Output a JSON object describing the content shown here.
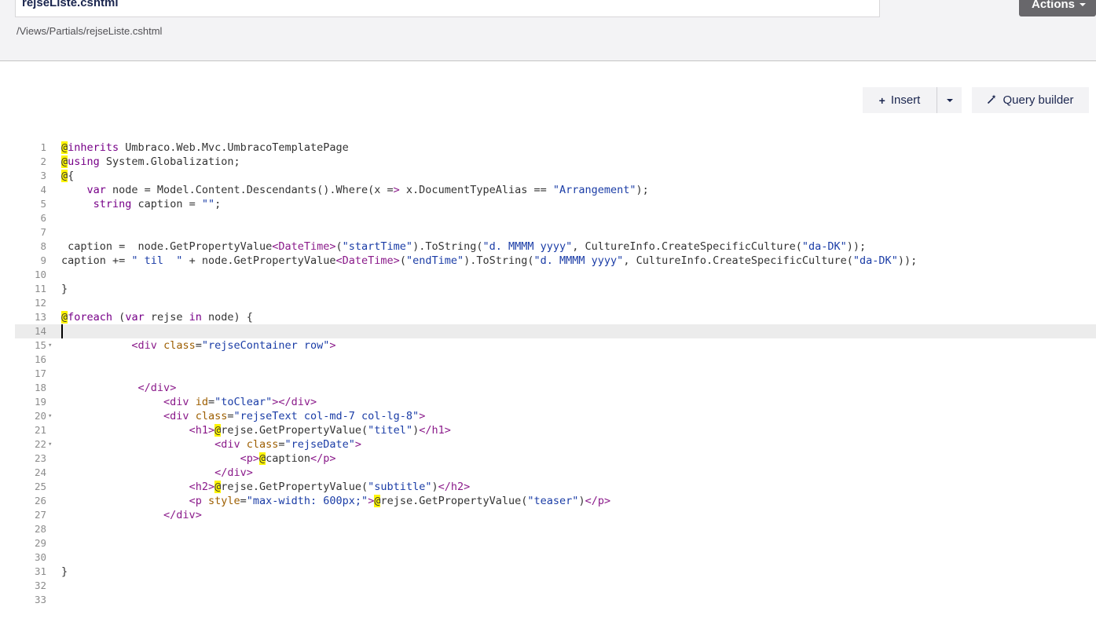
{
  "header": {
    "template_name": "rejseListe.cshtml",
    "path": "/Views/Partials/rejseListe.cshtml",
    "actions_label": "Actions"
  },
  "toolbar": {
    "insert_label": "Insert",
    "query_builder_label": "Query builder"
  },
  "icons": {
    "insert": "plus-icon",
    "insert_dropdown": "caret-down-icon",
    "query_builder": "magic-wand-icon"
  },
  "editor": {
    "active_line": 14,
    "line_numbers": [
      "1",
      "2",
      "3",
      "4",
      "5",
      "6",
      "7",
      "8",
      "9",
      "10",
      "11",
      "12",
      "13",
      "14",
      "15",
      "16",
      "17",
      "18",
      "19",
      "20",
      "21",
      "22",
      "23",
      "24",
      "25",
      "26",
      "27",
      "28",
      "29",
      "30",
      "31",
      "32",
      "33"
    ],
    "lines": [
      "@inherits Umbraco.Web.Mvc.UmbracoTemplatePage",
      "@using System.Globalization;",
      "@{",
      "    var node = Model.Content.Descendants().Where(x => x.DocumentTypeAlias == \"Arrangement\");",
      "     string caption = \"\";",
      "",
      "",
      " caption =  node.GetPropertyValue<DateTime>(\"startTime\").ToString(\"d. MMMM yyyy\", CultureInfo.CreateSpecificCulture(\"da-DK\"));",
      "caption += \" til  \" + node.GetPropertyValue<DateTime>(\"endTime\").ToString(\"d. MMMM yyyy\", CultureInfo.CreateSpecificCulture(\"da-DK\"));",
      "",
      "}",
      "",
      "@foreach (var rejse in node) {",
      "",
      "           <div class=\"rejseContainer row\">",
      "",
      "",
      "            </div>",
      "                <div id=\"toClear\"></div>",
      "                <div class=\"rejseText col-md-7 col-lg-8\">",
      "                    <h1>@rejse.GetPropertyValue(\"titel\")</h1>",
      "                        <div class=\"rejseDate\">",
      "                            <p>@caption</p>",
      "                        </div>",
      "                    <h2>@rejse.GetPropertyValue(\"subtitle\")</h2>",
      "                    <p style=\"max-width: 600px;\">@rejse.GetPropertyValue(\"teaser\")</p>",
      "                </div>",
      "",
      "",
      "",
      "}",
      "",
      ""
    ]
  }
}
